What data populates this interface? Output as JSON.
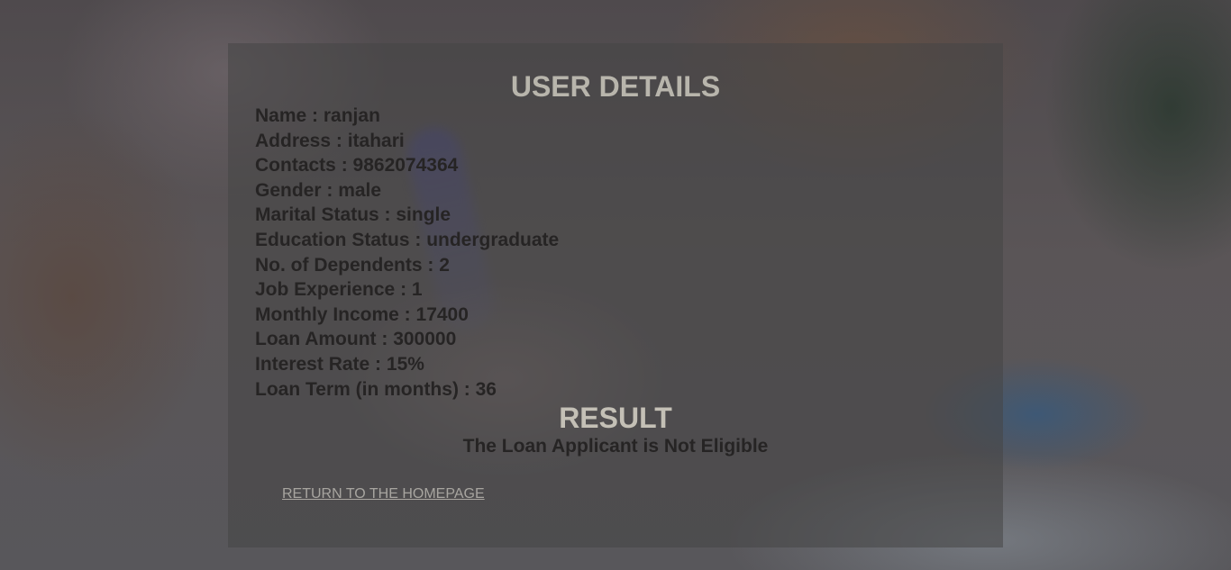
{
  "details_title": "USER DETAILS",
  "details": [
    {
      "label": "Name",
      "value": "ranjan"
    },
    {
      "label": "Address",
      "value": "itahari"
    },
    {
      "label": "Contacts",
      "value": "9862074364"
    },
    {
      "label": "Gender",
      "value": "male"
    },
    {
      "label": "Marital Status",
      "value": "single"
    },
    {
      "label": "Education Status",
      "value": "undergraduate"
    },
    {
      "label": "No. of Dependents",
      "value": "2"
    },
    {
      "label": "Job Experience",
      "value": "1"
    },
    {
      "label": "Monthly Income",
      "value": "17400"
    },
    {
      "label": "Loan Amount",
      "value": "300000"
    },
    {
      "label": "Interest Rate",
      "value": "15%"
    },
    {
      "label": "Loan Term (in months)",
      "value": "36"
    }
  ],
  "result": {
    "title": "RESULT",
    "text": "The Loan Applicant is Not Eligible"
  },
  "home_link": "RETURN TO THE HOMEPAGE"
}
